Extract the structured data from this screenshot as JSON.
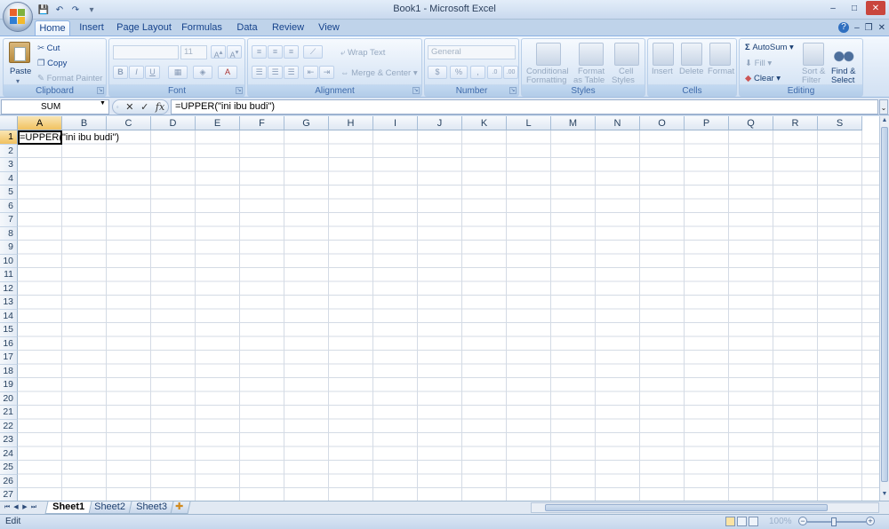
{
  "window": {
    "title": "Book1 - Microsoft Excel",
    "controls": [
      "–",
      "□",
      "✕"
    ]
  },
  "quick_access": [
    "💾",
    "↶",
    "↷"
  ],
  "tabs": [
    {
      "label": "Home",
      "active": true
    },
    {
      "label": "Insert"
    },
    {
      "label": "Page Layout"
    },
    {
      "label": "Formulas"
    },
    {
      "label": "Data"
    },
    {
      "label": "Review"
    },
    {
      "label": "View"
    }
  ],
  "ribbon": {
    "clipboard": {
      "label": "Clipboard",
      "paste": "Paste",
      "cut": "Cut",
      "copy": "Copy",
      "format_painter": "Format Painter"
    },
    "font": {
      "label": "Font",
      "font_name": "",
      "font_size": "11",
      "bold": "B",
      "italic": "I",
      "underline": "U"
    },
    "alignment": {
      "label": "Alignment",
      "wrap_text": "Wrap Text",
      "merge_center": "Merge & Center"
    },
    "number": {
      "label": "Number",
      "format": "General",
      "currency": "$",
      "percent": "%",
      "comma": ","
    },
    "styles": {
      "label": "Styles",
      "conditional": "Conditional",
      "conditional2": "Formatting",
      "format_table": "Format",
      "format_table2": "as Table",
      "cell_styles": "Cell",
      "cell_styles2": "Styles"
    },
    "cells": {
      "label": "Cells",
      "insert": "Insert",
      "delete": "Delete",
      "format": "Format"
    },
    "editing": {
      "label": "Editing",
      "autosum": "AutoSum",
      "fill": "Fill",
      "clear": "Clear",
      "sort": "Sort &",
      "sort2": "Filter",
      "find": "Find &",
      "find2": "Select"
    }
  },
  "formula_bar": {
    "name_box": "SUM",
    "cancel": "✕",
    "enter": "✓",
    "fx": "fx",
    "formula": "=UPPER(\"ini ibu budi\")"
  },
  "columns": [
    "A",
    "B",
    "C",
    "D",
    "E",
    "F",
    "G",
    "H",
    "I",
    "J",
    "K",
    "L",
    "M",
    "N",
    "O",
    "P",
    "Q",
    "R",
    "S"
  ],
  "rows": [
    "1",
    "2",
    "3",
    "4",
    "5",
    "6",
    "7",
    "8",
    "9",
    "10",
    "11",
    "12",
    "13",
    "14",
    "15",
    "16",
    "17",
    "18",
    "19",
    "20",
    "21",
    "22",
    "23",
    "24",
    "25",
    "26",
    "27"
  ],
  "active_cell": {
    "ref": "A1",
    "content": "=UPPER(\"ini ibu budi\")"
  },
  "sheets": [
    {
      "label": "Sheet1",
      "active": true
    },
    {
      "label": "Sheet2"
    },
    {
      "label": "Sheet3"
    }
  ],
  "status": {
    "mode": "Edit",
    "zoom": "100%"
  }
}
